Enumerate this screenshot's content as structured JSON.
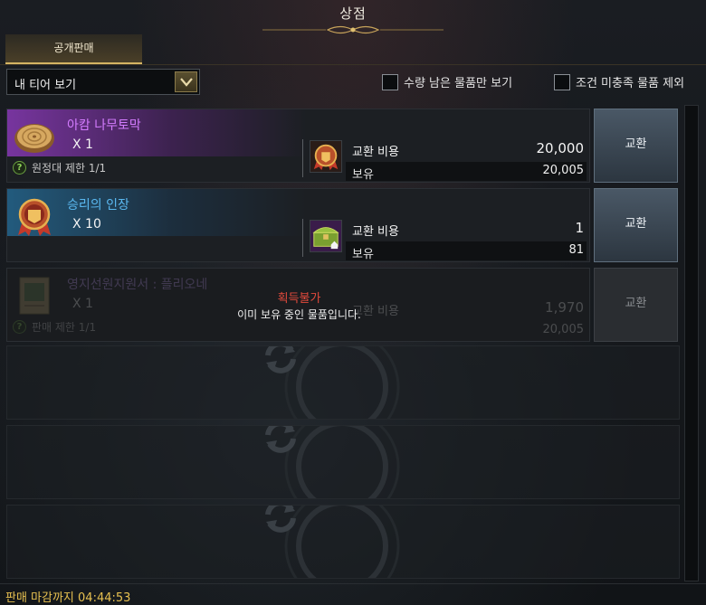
{
  "window": {
    "title": "상점"
  },
  "tabs": [
    {
      "label": "공개판매"
    }
  ],
  "filters": {
    "tier_dropdown": "내 티어 보기",
    "checkbox_remaining": "수량 남은 물품만 보기",
    "checkbox_exclude": "조건 미충족 물품 제외"
  },
  "items": [
    {
      "name": "아캄 나무토막",
      "name_color": "#d47cff",
      "qty": "X 1",
      "limit": "원정대 제한 1/1",
      "cost_label": "교환 비용",
      "cost": "20,000",
      "own_label": "보유",
      "own": "20,005",
      "button": "교환",
      "icon": "wood-log-icon",
      "cost_icon": "red-medal-icon"
    },
    {
      "name": "승리의 인장",
      "name_color": "#5ab8f0",
      "qty": "X 10",
      "cost_label": "교환 비용",
      "cost": "1",
      "own_label": "보유",
      "own": "81",
      "button": "교환",
      "icon": "red-medal-icon",
      "cost_icon": "treasure-chest-icon"
    },
    {
      "name": "영지선원지원서 : 플리오네",
      "name_color": "#c8a0ff",
      "qty": "X 1",
      "limit": "판매 제한 1/1",
      "cost_label": "교환 비용",
      "cost": "1,970",
      "own_label": "보유",
      "own": "20,005",
      "button": "교환",
      "icon": "document-icon",
      "cost_icon": "red-medal-icon",
      "disabled": true,
      "warning_title": "획득불가",
      "warning_message": "이미 보유 중인 물품입니다."
    }
  ],
  "empty_slots": 3,
  "footer": {
    "deadline": "판매 마감까지 04:44:53"
  }
}
